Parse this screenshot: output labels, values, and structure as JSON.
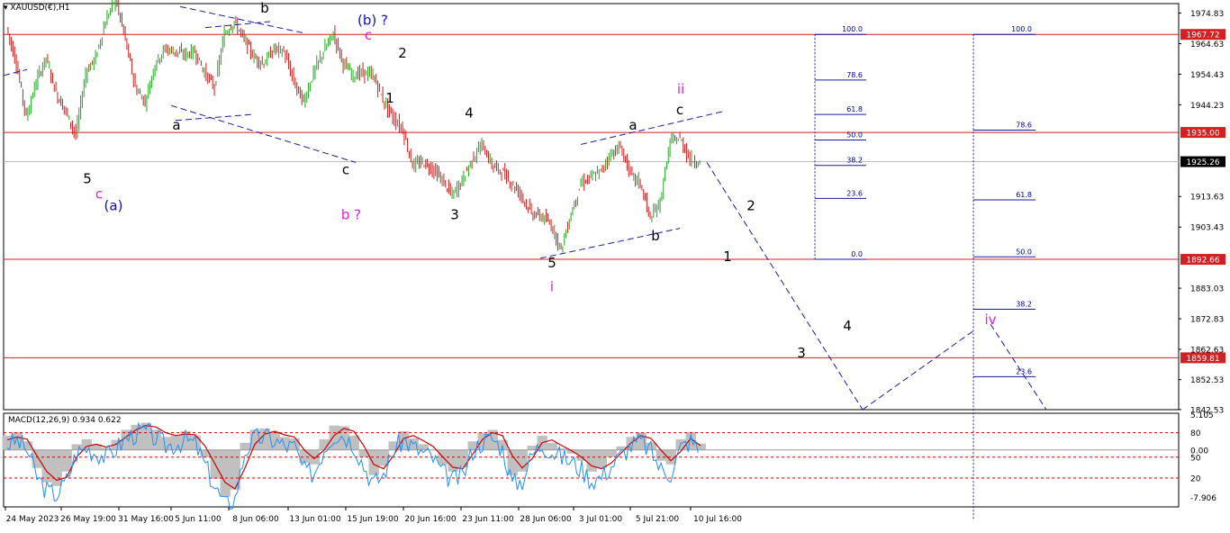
{
  "header": {
    "symbol_label": "XAUUSD(€),H1"
  },
  "colors": {
    "bull": "#22a822",
    "bear": "#d11a1a",
    "hline": "#d42020",
    "dash": "#1a1aa8",
    "magenta": "#e020e0",
    "navy": "#1010c0",
    "macd_hist": "#c0c0c0",
    "macd_signal": "#d00000",
    "macd_osc": "#1e90ff"
  },
  "chart_data": [
    {
      "type": "line",
      "series": [
        {
          "values": [
            1970,
            1958,
            1940,
            1952,
            1960,
            1948,
            1942,
            1934,
            1955,
            1960,
            1972,
            1980,
            1966,
            1950,
            1945,
            1958,
            1963,
            1962,
            1961,
            1962,
            1955,
            1950,
            1968,
            1972,
            1966,
            1960,
            1958,
            1963,
            1962,
            1952,
            1945,
            1955,
            1962,
            1968,
            1958,
            1954,
            1955,
            1954,
            1946,
            1940,
            1936,
            1924,
            1925,
            1923,
            1919,
            1914,
            1919,
            1926,
            1931,
            1924,
            1922,
            1918,
            1914,
            1908,
            1907,
            1904,
            1896,
            1908,
            1918,
            1920,
            1922,
            1928,
            1930,
            1921,
            1918,
            1906,
            1912,
            1932,
            1933,
            1926,
            1925
          ]
        }
      ],
      "x_tick_labels": [
        "24 May 2023",
        "26 May 19:00",
        "31 May 16:00",
        "5 Jun 11:00",
        "8 Jun 06:00",
        "13 Jun 01:00",
        "15 Jun 19:00",
        "20 Jun 16:00",
        "23 Jun 11:00",
        "28 Jun 06:00",
        "3 Jul 01:00",
        "5 Jul 21:00",
        "10 Jul 16:00"
      ],
      "y_tick_labels": [
        "1974.83",
        "1964.63",
        "1954.43",
        "1944.23",
        "1913.63",
        "1903.43",
        "1883.03",
        "1872.83",
        "1862.63",
        "1852.53",
        "1842.53"
      ],
      "ylim": [
        1842.5,
        1978
      ],
      "price_levels": [
        {
          "value": 1967.72,
          "label": "1967.72"
        },
        {
          "value": 1935.0,
          "label": "1935.00"
        },
        {
          "value": 1925.26,
          "label": "1925.26"
        },
        {
          "value": 1892.66,
          "label": "1892.66"
        },
        {
          "value": 1859.81,
          "label": "1859.81"
        }
      ],
      "fib_retracement_1": [
        {
          "label": "100.0",
          "value": 1967.72
        },
        {
          "label": "78.6",
          "value": 1952.5
        },
        {
          "label": "61.8",
          "value": 1941.0
        },
        {
          "label": "50.0",
          "value": 1932.5
        },
        {
          "label": "38.2",
          "value": 1924.0
        },
        {
          "label": "23.6",
          "value": 1913.0
        },
        {
          "label": "0.0",
          "value": 1892.66
        }
      ],
      "fib_retracement_2": [
        {
          "label": "100.0",
          "value": 1967.72
        },
        {
          "label": "78.6",
          "value": 1935.8
        },
        {
          "label": "61.8",
          "value": 1912.5
        },
        {
          "label": "50.0",
          "value": 1893.5
        },
        {
          "label": "38.2",
          "value": 1876.0
        },
        {
          "label": "23.6",
          "value": 1853.5
        }
      ],
      "wave_labels": [
        {
          "text": "5",
          "color": "black"
        },
        {
          "text": "c",
          "color": "magenta"
        },
        {
          "text": "(a)",
          "color": "navy"
        },
        {
          "text": "a",
          "color": "black"
        },
        {
          "text": "b",
          "color": "black"
        },
        {
          "text": "c",
          "color": "black"
        },
        {
          "text": "b ?",
          "color": "magenta"
        },
        {
          "text": "(b) ?",
          "color": "navy"
        },
        {
          "text": "c",
          "color": "magenta"
        },
        {
          "text": "1",
          "color": "black"
        },
        {
          "text": "2",
          "color": "black"
        },
        {
          "text": "3",
          "color": "black"
        },
        {
          "text": "4",
          "color": "black"
        },
        {
          "text": "5",
          "color": "black"
        },
        {
          "text": "i",
          "color": "magenta"
        },
        {
          "text": "a",
          "color": "black"
        },
        {
          "text": "b",
          "color": "black"
        },
        {
          "text": "c",
          "color": "black"
        },
        {
          "text": "ii",
          "color": "magenta"
        },
        {
          "text": "2",
          "color": "black"
        },
        {
          "text": "1",
          "color": "black"
        },
        {
          "text": "3",
          "color": "black"
        },
        {
          "text": "4",
          "color": "black"
        },
        {
          "text": "iv",
          "color": "magenta"
        }
      ]
    },
    {
      "type": "area",
      "title": "MACD(12,26,9) 0.934 0.622",
      "y_tick_labels": [
        "5.105",
        "80",
        "0.00",
        "50",
        "20",
        "-7.906"
      ],
      "ylim": [
        -7.906,
        5.105
      ],
      "macd_values": [
        2.0,
        2.5,
        1.2,
        -2.5,
        -4.5,
        -5.0,
        -3.0,
        0.8,
        1.5,
        0.8,
        0.3,
        1.4,
        2.8,
        3.5,
        3.8,
        2.8,
        1.8,
        2.0,
        2.6,
        2.0,
        -1.0,
        -4.0,
        -6.5,
        -5.5,
        1.0,
        2.8,
        3.0,
        2.5,
        1.8,
        1.6,
        -1.8,
        -2.0,
        1.5,
        3.4,
        3.3,
        2.0,
        -1.0,
        -3.5,
        -2.2,
        1.2,
        2.6,
        1.6,
        0.8,
        0.0,
        -2.0,
        -3.0,
        -2.4,
        1.2,
        2.4,
        2.8,
        1.4,
        -3.5,
        -3.0,
        0.6,
        2.0,
        1.0,
        0.2,
        -0.5,
        -1.5,
        -3.0,
        -2.5,
        -1.0,
        0.5,
        1.8,
        2.4,
        1.0,
        -1.5,
        -2.0,
        1.5,
        2.5,
        0.9
      ],
      "signal_values": [
        1.4,
        1.8,
        1.5,
        -0.8,
        -3.0,
        -4.2,
        -3.8,
        -1.0,
        0.5,
        0.8,
        0.4,
        0.8,
        1.8,
        2.8,
        3.4,
        3.2,
        2.4,
        2.0,
        2.2,
        2.1,
        0.5,
        -2.0,
        -4.5,
        -5.4,
        -2.5,
        0.8,
        2.2,
        2.6,
        2.1,
        1.8,
        0.0,
        -1.2,
        0.0,
        2.0,
        3.0,
        2.6,
        0.6,
        -2.0,
        -2.6,
        -0.8,
        1.6,
        2.0,
        1.3,
        0.5,
        -1.0,
        -2.4,
        -2.6,
        -0.6,
        1.5,
        2.4,
        2.0,
        -0.8,
        -2.5,
        -1.2,
        1.0,
        1.4,
        0.6,
        -0.1,
        -1.0,
        -2.2,
        -2.6,
        -1.8,
        -0.4,
        1.0,
        2.0,
        1.6,
        0.0,
        -1.5,
        -0.2,
        1.6,
        0.6
      ]
    }
  ]
}
